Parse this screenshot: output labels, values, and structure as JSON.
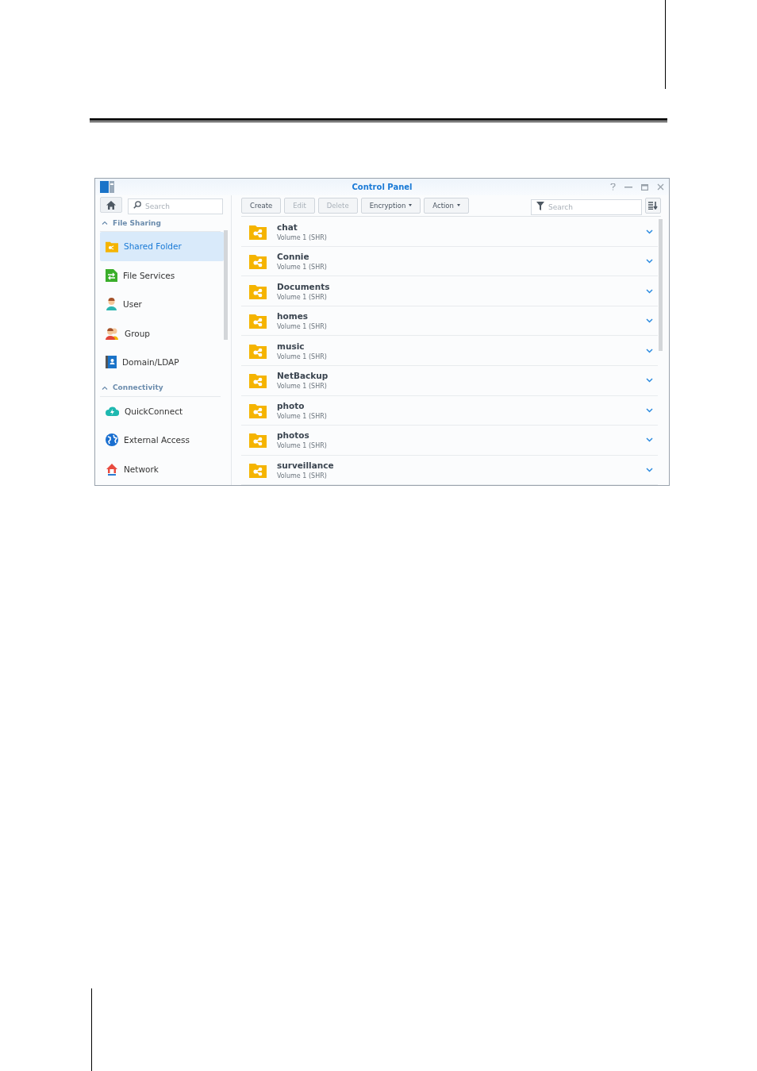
{
  "window": {
    "title": "Control Panel"
  },
  "sidebar": {
    "search": {
      "placeholder": "Search"
    },
    "sections": [
      {
        "label": "File Sharing",
        "expanded": true,
        "items": [
          {
            "label": "Shared Folder",
            "kind": "shared-folder",
            "selected": true
          },
          {
            "label": "File Services",
            "kind": "file-services",
            "selected": false
          },
          {
            "label": "User",
            "kind": "user",
            "selected": false
          },
          {
            "label": "Group",
            "kind": "group",
            "selected": false
          },
          {
            "label": "Domain/LDAP",
            "kind": "domain",
            "selected": false
          }
        ]
      },
      {
        "label": "Connectivity",
        "expanded": true,
        "items": [
          {
            "label": "QuickConnect",
            "kind": "cloud",
            "selected": false
          },
          {
            "label": "External Access",
            "kind": "globe",
            "selected": false
          },
          {
            "label": "Network",
            "kind": "house",
            "selected": false
          }
        ]
      }
    ]
  },
  "toolbar": {
    "buttons": [
      {
        "label": "Create",
        "disabled": false,
        "dropdown": false
      },
      {
        "label": "Edit",
        "disabled": true,
        "dropdown": false
      },
      {
        "label": "Delete",
        "disabled": true,
        "dropdown": false
      },
      {
        "label": "Encryption",
        "disabled": false,
        "dropdown": true
      },
      {
        "label": "Action",
        "disabled": false,
        "dropdown": true
      }
    ],
    "filter": {
      "placeholder": "Search"
    }
  },
  "folders": [
    {
      "name": "chat",
      "location": "Volume 1 (SHR)"
    },
    {
      "name": "Connie",
      "location": "Volume 1 (SHR)"
    },
    {
      "name": "Documents",
      "location": "Volume 1 (SHR)"
    },
    {
      "name": "homes",
      "location": "Volume 1 (SHR)"
    },
    {
      "name": "music",
      "location": "Volume 1 (SHR)"
    },
    {
      "name": "NetBackup",
      "location": "Volume 1 (SHR)"
    },
    {
      "name": "photo",
      "location": "Volume 1 (SHR)"
    },
    {
      "name": "photos",
      "location": "Volume 1 (SHR)"
    },
    {
      "name": "surveillance",
      "location": "Volume 1 (SHR)"
    }
  ]
}
